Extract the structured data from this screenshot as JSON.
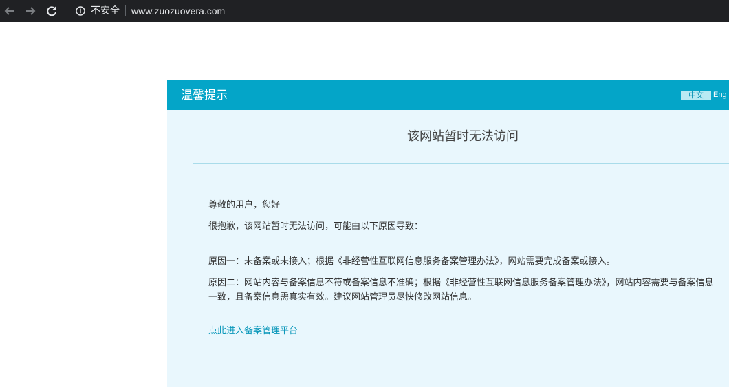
{
  "browser": {
    "back_icon": "arrow-left-icon",
    "forward_icon": "arrow-right-icon",
    "reload_icon": "reload-icon",
    "security_icon": "info-icon",
    "security_label": "不安全",
    "url": "www.zuozuovera.com"
  },
  "notice": {
    "title": "温馨提示",
    "lang_zh": "中文",
    "lang_en": "Eng",
    "heading": "该网站暂时无法访问",
    "greeting": "尊敬的用户，您好",
    "intro": "很抱歉，该网站暂时无法访问，可能由以下原因导致：",
    "reason1": "原因一：未备案或未接入；根据《非经营性互联网信息服务备案管理办法》，网站需要完成备案或接入。",
    "reason2": "原因二：网站内容与备案信息不符或备案信息不准确；根据《非经营性互联网信息服务备案管理办法》，网站内容需要与备案信息一致，且备案信息需真实有效。建议网站管理员尽快修改网站信息。",
    "link": "点此进入备案管理平台"
  },
  "colors": {
    "browser_bar": "#202124",
    "header": "#04a5c8",
    "panel_bg": "#e9f7fd",
    "link": "#0796b9"
  }
}
